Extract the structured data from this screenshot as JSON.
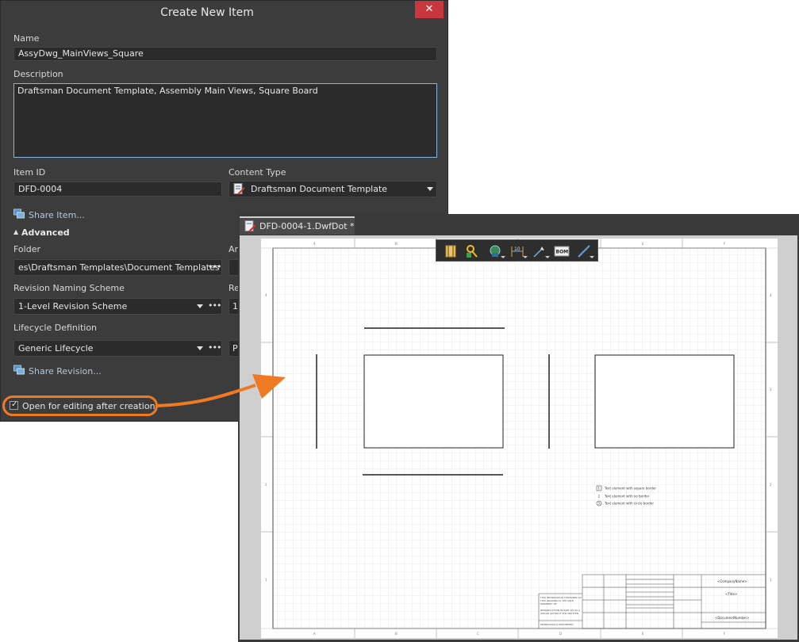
{
  "dialog": {
    "title": "Create New Item",
    "close_symbol": "✕",
    "name_label": "Name",
    "name_value": "AssyDwg_MainViews_Square",
    "description_label": "Description",
    "description_value": "Draftsman Document Template, Assembly Main Views, Square Board",
    "item_id_label": "Item ID",
    "item_id_value": "DFD-0004",
    "content_type_label": "Content Type",
    "content_type_value": "Draftsman Document Template",
    "share_item_link": "Share Item...",
    "advanced_label": "Advanced",
    "advanced_toggle": "▲",
    "folder_label": "Folder",
    "folder_value": "es\\Draftsman Templates\\Document Templates",
    "right_col_label_1": "Ar",
    "revision_scheme_label": "Revision Naming Scheme",
    "revision_scheme_value": "1-Level Revision Scheme",
    "right_col_label_2": "Re",
    "right_col_value_2": "1",
    "lifecycle_label": "Lifecycle Definition",
    "lifecycle_value": "Generic Lifecycle",
    "right_col_value_3": "P",
    "share_revision_link": "Share Revision...",
    "open_editing_label": "Open for editing after creation",
    "open_editing_checked": true,
    "ellipsis": "•••"
  },
  "document": {
    "tab_title": "DFD-0004-1.DwfDot *",
    "toolbar_icons": [
      "component-icon",
      "key-icon",
      "board-view-icon",
      "dimension-icon",
      "note-icon",
      "bom-icon",
      "line-icon"
    ],
    "bom_label": "BOM",
    "legend": [
      {
        "marker": "1",
        "text": "Text element with square border"
      },
      {
        "marker": "2",
        "text": "Text element with no border"
      },
      {
        "marker": "3",
        "text": "Text element with circle border"
      }
    ],
    "title_block": {
      "company": "<CompanyName>",
      "title": "<Title>",
      "document_number": "<DocumentNumber>"
    }
  },
  "colors": {
    "dialog_bg": "#3c3c3c",
    "field_bg": "#2b2b2b",
    "accent_orange": "#ef7a22",
    "close_red": "#c8373c",
    "link": "#b7c7d8"
  }
}
